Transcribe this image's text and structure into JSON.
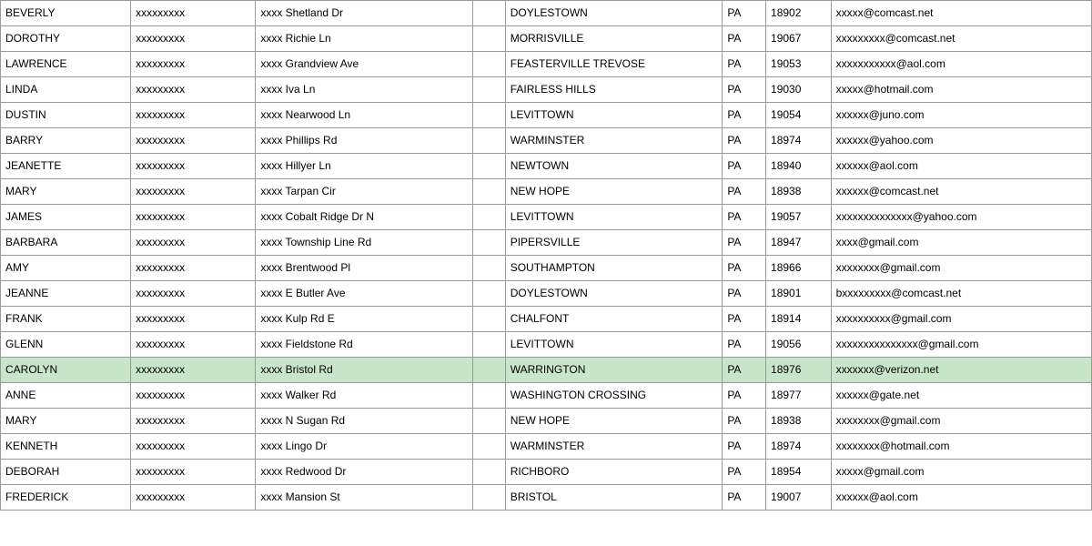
{
  "table": {
    "rows": [
      {
        "first": "BEVERLY",
        "last": "xxxxxxxxx",
        "address": "xxxx Shetland Dr",
        "unit": "",
        "city": "DOYLESTOWN",
        "state": "PA",
        "zip": "18902",
        "email": "xxxxx@comcast.net"
      },
      {
        "first": "DOROTHY",
        "last": "xxxxxxxxx",
        "address": "xxxx Richie Ln",
        "unit": "",
        "city": "MORRISVILLE",
        "state": "PA",
        "zip": "19067",
        "email": "xxxxxxxxx@comcast.net"
      },
      {
        "first": "LAWRENCE",
        "last": "xxxxxxxxx",
        "address": "xxxx Grandview Ave",
        "unit": "",
        "city": "FEASTERVILLE TREVOSE",
        "state": "PA",
        "zip": "19053",
        "email": "xxxxxxxxxxx@aol.com"
      },
      {
        "first": "LINDA",
        "last": "xxxxxxxxx",
        "address": "xxxx Iva Ln",
        "unit": "",
        "city": "FAIRLESS HILLS",
        "state": "PA",
        "zip": "19030",
        "email": "xxxxx@hotmail.com"
      },
      {
        "first": "DUSTIN",
        "last": "xxxxxxxxx",
        "address": "xxxx Nearwood Ln",
        "unit": "",
        "city": "LEVITTOWN",
        "state": "PA",
        "zip": "19054",
        "email": "xxxxxx@juno.com"
      },
      {
        "first": "BARRY",
        "last": "xxxxxxxxx",
        "address": "xxxx Phillips Rd",
        "unit": "",
        "city": "WARMINSTER",
        "state": "PA",
        "zip": "18974",
        "email": "xxxxxx@yahoo.com"
      },
      {
        "first": "JEANETTE",
        "last": "xxxxxxxxx",
        "address": "xxxx Hillyer Ln",
        "unit": "",
        "city": "NEWTOWN",
        "state": "PA",
        "zip": "18940",
        "email": "xxxxxx@aol.com"
      },
      {
        "first": "MARY",
        "last": "xxxxxxxxx",
        "address": "xxxx Tarpan Cir",
        "unit": "",
        "city": "NEW HOPE",
        "state": "PA",
        "zip": "18938",
        "email": "xxxxxx@comcast.net"
      },
      {
        "first": "JAMES",
        "last": "xxxxxxxxx",
        "address": "xxxx Cobalt Ridge Dr N",
        "unit": "",
        "city": "LEVITTOWN",
        "state": "PA",
        "zip": "19057",
        "email": "xxxxxxxxxxxxxx@yahoo.com"
      },
      {
        "first": "BARBARA",
        "last": "xxxxxxxxx",
        "address": "xxxx Township Line Rd",
        "unit": "",
        "city": "PIPERSVILLE",
        "state": "PA",
        "zip": "18947",
        "email": "xxxx@gmail.com"
      },
      {
        "first": "AMY",
        "last": "xxxxxxxxx",
        "address": "xxxx Brentwood Pl",
        "unit": "",
        "city": "SOUTHAMPTON",
        "state": "PA",
        "zip": "18966",
        "email": "xxxxxxxx@gmail.com"
      },
      {
        "first": "JEANNE",
        "last": "xxxxxxxxx",
        "address": "xxxx E Butler Ave",
        "unit": "",
        "city": "DOYLESTOWN",
        "state": "PA",
        "zip": "18901",
        "email": "bxxxxxxxxx@comcast.net"
      },
      {
        "first": "FRANK",
        "last": "xxxxxxxxx",
        "address": "xxxx Kulp Rd E",
        "unit": "",
        "city": "CHALFONT",
        "state": "PA",
        "zip": "18914",
        "email": "xxxxxxxxxx@gmail.com"
      },
      {
        "first": "GLENN",
        "last": "xxxxxxxxx",
        "address": "xxxx Fieldstone Rd",
        "unit": "",
        "city": "LEVITTOWN",
        "state": "PA",
        "zip": "19056",
        "email": "xxxxxxxxxxxxxxx@gmail.com"
      },
      {
        "first": "CAROLYN",
        "last": "xxxxxxxxx",
        "address": "xxxx Bristol Rd",
        "unit": "",
        "city": "WARRINGTON",
        "state": "PA",
        "zip": "18976",
        "email": "xxxxxxx@verizon.net",
        "highlight": true
      },
      {
        "first": "ANNE",
        "last": "xxxxxxxxx",
        "address": "xxxx Walker Rd",
        "unit": "",
        "city": "WASHINGTON CROSSING",
        "state": "PA",
        "zip": "18977",
        "email": "xxxxxx@gate.net"
      },
      {
        "first": "MARY",
        "last": "xxxxxxxxx",
        "address": "xxxx N Sugan Rd",
        "unit": "",
        "city": "NEW HOPE",
        "state": "PA",
        "zip": "18938",
        "email": "xxxxxxxx@gmail.com"
      },
      {
        "first": "KENNETH",
        "last": "xxxxxxxxx",
        "address": "xxxx Lingo Dr",
        "unit": "",
        "city": "WARMINSTER",
        "state": "PA",
        "zip": "18974",
        "email": "xxxxxxxx@hotmail.com"
      },
      {
        "first": "DEBORAH",
        "last": "xxxxxxxxx",
        "address": "xxxx Redwood Dr",
        "unit": "",
        "city": "RICHBORO",
        "state": "PA",
        "zip": "18954",
        "email": "xxxxx@gmail.com"
      },
      {
        "first": "FREDERICK",
        "last": "xxxxxxxxx",
        "address": "xxxx Mansion St",
        "unit": "",
        "city": "BRISTOL",
        "state": "PA",
        "zip": "19007",
        "email": "xxxxxx@aol.com"
      }
    ]
  }
}
